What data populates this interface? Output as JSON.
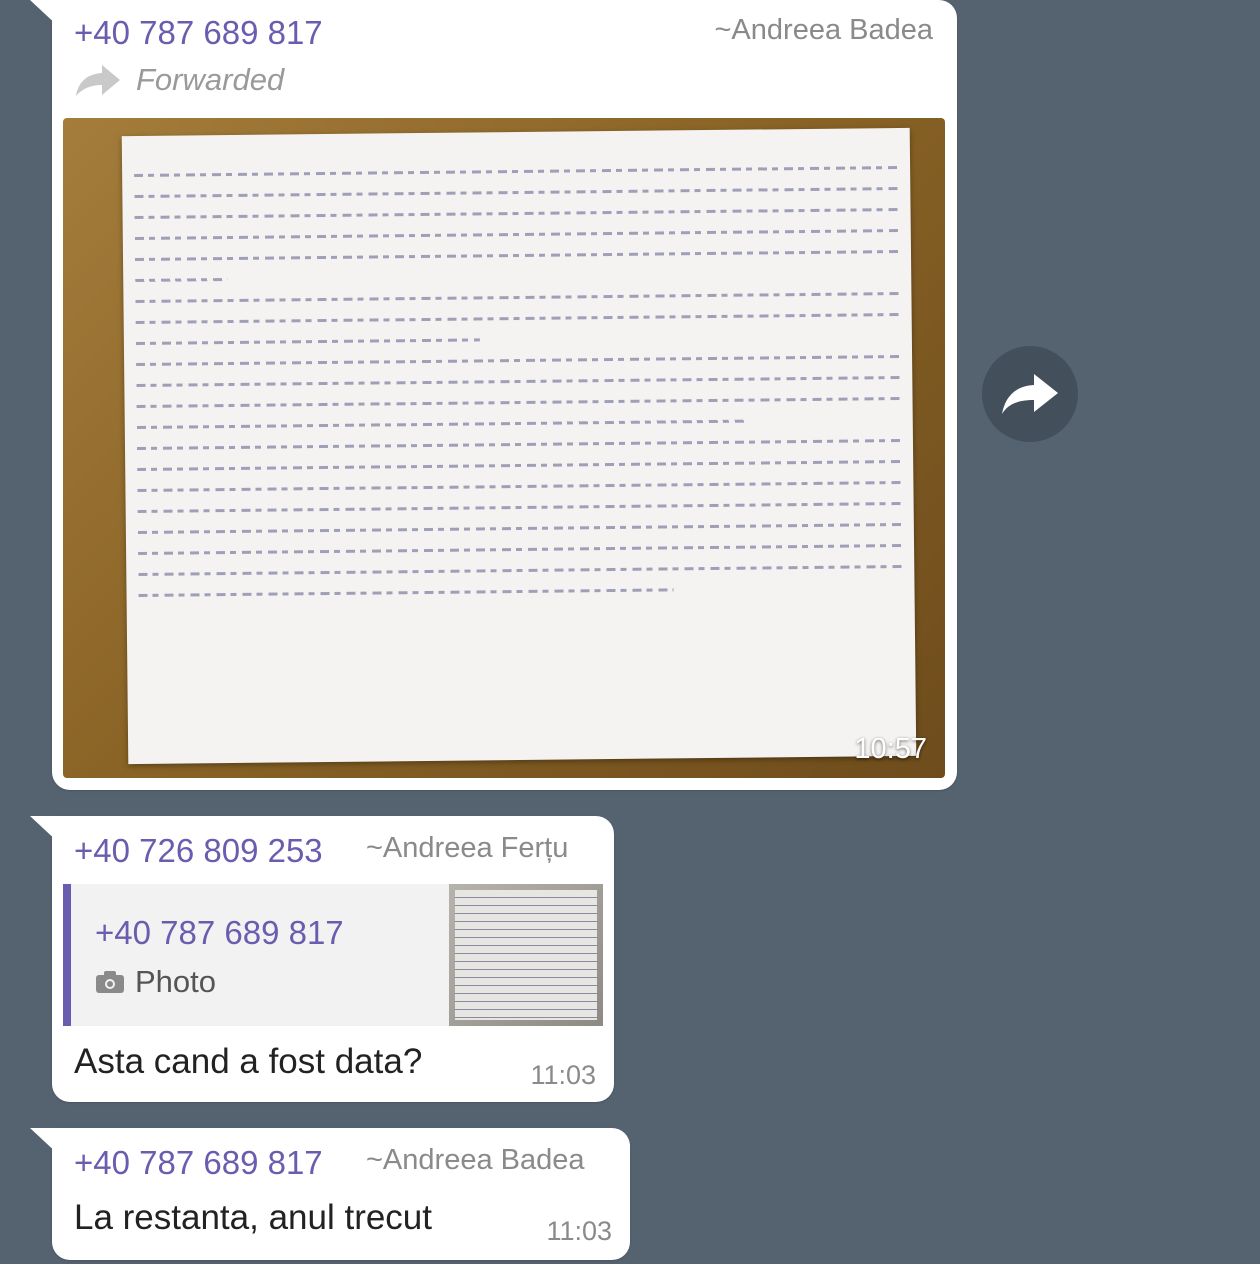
{
  "messages": [
    {
      "sender_phone": "+40 787 689 817",
      "sender_alias": "~Andreea Badea",
      "forwarded_label": "Forwarded",
      "attachment": "photo",
      "time": "10:57"
    },
    {
      "sender_phone": "+40 726 809 253",
      "sender_alias": "~Andreea Ferțu",
      "reply_to": {
        "phone": "+40 787 689 817",
        "type_label": "Photo"
      },
      "text": "Asta cand a fost data?",
      "time": "11:03"
    },
    {
      "sender_phone": "+40 787 689 817",
      "sender_alias": "~Andreea Badea",
      "text": "La restanta, anul trecut",
      "time": "11:03"
    }
  ],
  "icons": {
    "forward": "forward-arrow-icon",
    "share": "share-icon",
    "camera": "camera-icon"
  },
  "colors": {
    "background": "#556270",
    "accent": "#6a5cae",
    "bubble": "#ffffff"
  }
}
